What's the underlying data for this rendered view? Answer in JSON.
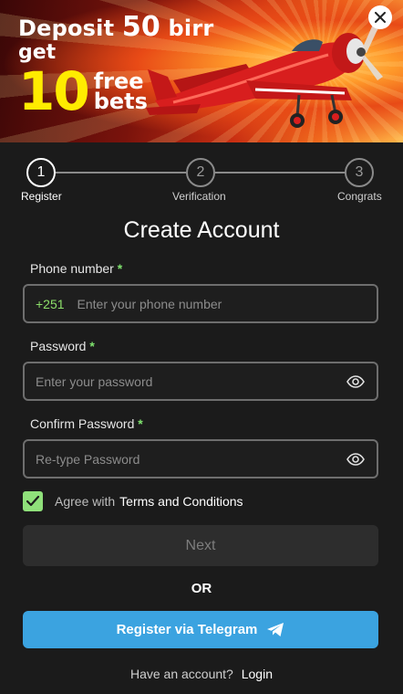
{
  "banner": {
    "word_deposit": "Deposit",
    "amount": "50",
    "currency": "birr",
    "word_get": "get",
    "bets_count": "10",
    "word_free": "free",
    "word_bets": "bets"
  },
  "close_icon": "close-icon",
  "stepper": {
    "steps": [
      {
        "number": "1",
        "label": "Register",
        "active": true
      },
      {
        "number": "2",
        "label": "Verification",
        "active": false
      },
      {
        "number": "3",
        "label": "Congrats",
        "active": false
      }
    ]
  },
  "form": {
    "title": "Create Account",
    "required_mark": "*",
    "phone": {
      "label": "Phone number",
      "prefix": "+251",
      "placeholder": "Enter your phone number",
      "value": ""
    },
    "password": {
      "label": "Password",
      "placeholder": "Enter your password",
      "value": ""
    },
    "confirm": {
      "label": "Confirm Password",
      "placeholder": "Re-type Password",
      "value": ""
    },
    "agree": {
      "text": "Agree with",
      "link": "Terms and Conditions",
      "checked": true
    },
    "next_label": "Next",
    "or_label": "OR",
    "telegram_label": "Register via Telegram",
    "footer_question": "Have an account?",
    "footer_link": "Login"
  },
  "colors": {
    "accent_green": "#8fe07a",
    "telegram_blue": "#3ba3e0",
    "promo_yellow": "#ffec00",
    "background": "#1b1b1b"
  }
}
